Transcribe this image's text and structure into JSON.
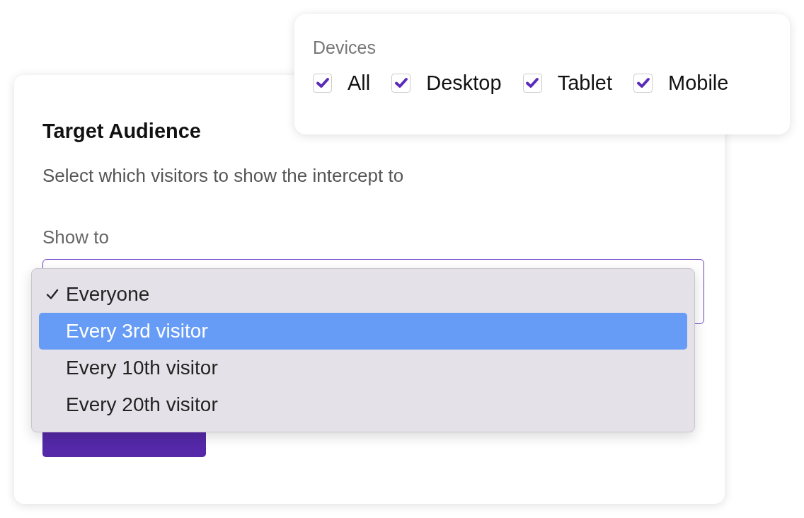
{
  "card": {
    "title": "Target Audience",
    "subtitle": "Select which visitors to show the intercept to",
    "show_to": {
      "label": "Show to"
    }
  },
  "dropdown": {
    "options": [
      {
        "label": "Everyone",
        "selected": true,
        "highlighted": false
      },
      {
        "label": "Every 3rd visitor",
        "selected": false,
        "highlighted": true
      },
      {
        "label": "Every 10th visitor",
        "selected": false,
        "highlighted": false
      },
      {
        "label": "Every 20th visitor",
        "selected": false,
        "highlighted": false
      }
    ]
  },
  "devices": {
    "label": "Devices",
    "options": [
      {
        "label": "All",
        "checked": true
      },
      {
        "label": "Desktop",
        "checked": true
      },
      {
        "label": "Tablet",
        "checked": true
      },
      {
        "label": "Mobile",
        "checked": true
      }
    ]
  }
}
